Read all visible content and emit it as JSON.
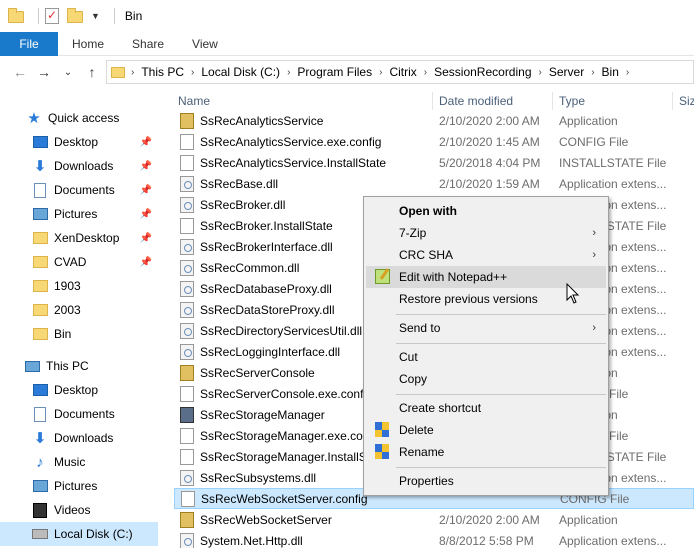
{
  "window": {
    "title": "Bin"
  },
  "ribbon": {
    "tabs": [
      "File",
      "Home",
      "Share",
      "View"
    ]
  },
  "address": {
    "crumbs": [
      "This PC",
      "Local Disk (C:)",
      "Program Files",
      "Citrix",
      "SessionRecording",
      "Server",
      "Bin"
    ]
  },
  "nav": {
    "items": [
      {
        "label": "Quick access",
        "icon": "star-icon",
        "pinned": false
      },
      {
        "label": "Desktop",
        "icon": "desktop-icon",
        "pinned": true
      },
      {
        "label": "Downloads",
        "icon": "downloads-icon",
        "pinned": true
      },
      {
        "label": "Documents",
        "icon": "documents-icon",
        "pinned": true
      },
      {
        "label": "Pictures",
        "icon": "pictures-icon",
        "pinned": true
      },
      {
        "label": "XenDesktop",
        "icon": "folder-icon",
        "pinned": true
      },
      {
        "label": "CVAD",
        "icon": "folder-icon",
        "pinned": true
      },
      {
        "label": "1903",
        "icon": "folder-icon",
        "pinned": false
      },
      {
        "label": "2003",
        "icon": "folder-icon",
        "pinned": false
      },
      {
        "label": "Bin",
        "icon": "folder-icon",
        "pinned": false
      },
      {
        "label": "This PC",
        "icon": "pc-icon",
        "pinned": false
      },
      {
        "label": "Desktop",
        "icon": "desktop-icon",
        "pinned": false
      },
      {
        "label": "Documents",
        "icon": "documents-icon",
        "pinned": false
      },
      {
        "label": "Downloads",
        "icon": "downloads-icon",
        "pinned": false
      },
      {
        "label": "Music",
        "icon": "music-icon",
        "pinned": false
      },
      {
        "label": "Pictures",
        "icon": "pictures-icon",
        "pinned": false
      },
      {
        "label": "Videos",
        "icon": "videos-icon",
        "pinned": false
      },
      {
        "label": "Local Disk (C:)",
        "icon": "drive-icon",
        "pinned": false
      }
    ]
  },
  "columns": {
    "name": "Name",
    "date": "Date modified",
    "type": "Type",
    "size": "Siz"
  },
  "files": [
    {
      "name": "SsRecAnalyticsService",
      "date": "2/10/2020 2:00 AM",
      "type": "Application",
      "icon": "app"
    },
    {
      "name": "SsRecAnalyticsService.exe.config",
      "date": "2/10/2020 1:45 AM",
      "type": "CONFIG File",
      "icon": "doc"
    },
    {
      "name": "SsRecAnalyticsService.InstallState",
      "date": "5/20/2018 4:04 PM",
      "type": "INSTALLSTATE File",
      "icon": "doc"
    },
    {
      "name": "SsRecBase.dll",
      "date": "2/10/2020 1:59 AM",
      "type": "Application extens...",
      "icon": "dll"
    },
    {
      "name": "SsRecBroker.dll",
      "date": "",
      "type": "Application extens...",
      "icon": "dll"
    },
    {
      "name": "SsRecBroker.InstallState",
      "date": "",
      "type": "INSTALLSTATE File",
      "icon": "doc"
    },
    {
      "name": "SsRecBrokerInterface.dll",
      "date": "",
      "type": "Application extens...",
      "icon": "dll"
    },
    {
      "name": "SsRecCommon.dll",
      "date": "",
      "type": "Application extens...",
      "icon": "dll"
    },
    {
      "name": "SsRecDatabaseProxy.dll",
      "date": "",
      "type": "Application extens...",
      "icon": "dll"
    },
    {
      "name": "SsRecDataStoreProxy.dll",
      "date": "",
      "type": "Application extens...",
      "icon": "dll"
    },
    {
      "name": "SsRecDirectoryServicesUtil.dll",
      "date": "",
      "type": "Application extens...",
      "icon": "dll"
    },
    {
      "name": "SsRecLoggingInterface.dll",
      "date": "",
      "type": "Application extens...",
      "icon": "dll"
    },
    {
      "name": "SsRecServerConsole",
      "date": "",
      "type": "Application",
      "icon": "app"
    },
    {
      "name": "SsRecServerConsole.exe.config",
      "date": "",
      "type": "CONFIG File",
      "icon": "doc"
    },
    {
      "name": "SsRecStorageManager",
      "date": "",
      "type": "Application",
      "icon": "app2"
    },
    {
      "name": "SsRecStorageManager.exe.config",
      "date": "",
      "type": "CONFIG File",
      "icon": "doc"
    },
    {
      "name": "SsRecStorageManager.InstallState",
      "date": "",
      "type": "INSTALLSTATE File",
      "icon": "doc"
    },
    {
      "name": "SsRecSubsystems.dll",
      "date": "",
      "type": "Application extens...",
      "icon": "dll"
    },
    {
      "name": "SsRecWebSocketServer.config",
      "date": "",
      "type": "CONFIG File",
      "icon": "doc",
      "selected": true
    },
    {
      "name": "SsRecWebSocketServer",
      "date": "2/10/2020 2:00 AM",
      "type": "Application",
      "icon": "app"
    },
    {
      "name": "System.Net.Http.dll",
      "date": "8/8/2012 5:58 PM",
      "type": "Application extens...",
      "icon": "dll"
    }
  ],
  "context_menu": {
    "items": [
      {
        "label": "Open with",
        "bold": true
      },
      {
        "label": "7-Zip",
        "submenu": true
      },
      {
        "label": "CRC SHA",
        "submenu": true
      },
      {
        "label": "Edit with Notepad++",
        "icon": "notepadpp-icon",
        "hover": true
      },
      {
        "label": "Restore previous versions"
      },
      {
        "label": "Send to",
        "submenu": true
      },
      {
        "label": "Cut"
      },
      {
        "label": "Copy"
      },
      {
        "label": "Create shortcut"
      },
      {
        "label": "Delete",
        "icon": "shield-icon"
      },
      {
        "label": "Rename",
        "icon": "shield-icon"
      },
      {
        "label": "Properties"
      }
    ]
  },
  "colors": {
    "file_tab": "#1979ca",
    "selection": "#cce8ff",
    "menu_bg": "#f0f0f0"
  }
}
